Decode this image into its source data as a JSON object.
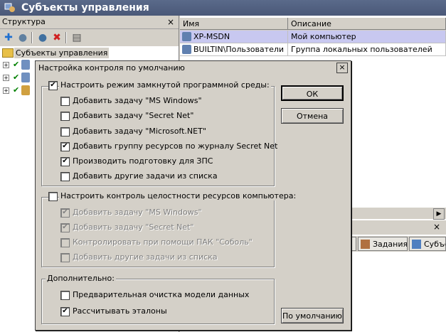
{
  "app": {
    "title": "Субъекты управления"
  },
  "left_pane": {
    "header": "Структура",
    "close_glyph": "×",
    "tree_root": "Субъекты управления"
  },
  "grid": {
    "columns": [
      "Имя",
      "Описание"
    ],
    "rows": [
      {
        "name": "XP-MSDN",
        "description": "Мой компьютер",
        "selected": true
      },
      {
        "name": "BUILTIN\\Пользователи",
        "description": "Группа локальных пользователей",
        "selected": false
      }
    ]
  },
  "bottom_panel": {
    "close_glyph": "×",
    "tabs": [
      "и",
      "Задания",
      "Субъе"
    ]
  },
  "dialog": {
    "title": "Настройка контроля по умолчанию",
    "close_glyph": "×",
    "group1": {
      "label": "Настроить режим замкнутой программной среды:",
      "checked": true,
      "items": [
        {
          "label": "Добавить задачу \"MS Windows\"",
          "checked": false
        },
        {
          "label": "Добавить задачу \"Secret Net\"",
          "checked": false
        },
        {
          "label": "Добавить задачу \"Microsoft.NET\"",
          "checked": false
        },
        {
          "label": "Добавить группу ресурсов по журналу Secret Net",
          "checked": true
        },
        {
          "label": "Производить подготовку для ЗПС",
          "checked": true
        },
        {
          "label": "Добавить другие задачи из списка",
          "checked": false
        }
      ]
    },
    "group2": {
      "label": "Настроить контроль целостности ресурсов компьютера:",
      "checked": false,
      "items": [
        {
          "label": "Добавить задачу \"MS Windows\"",
          "checked": true
        },
        {
          "label": "Добавить задачу \"Secret Net\"",
          "checked": true
        },
        {
          "label": "Контролировать при помощи ПАК \"Соболь\"",
          "checked": false
        },
        {
          "label": "Добавить другие задачи из списка",
          "checked": false
        }
      ]
    },
    "group3": {
      "label": "Дополнительно:",
      "items": [
        {
          "label": "Предварительная очистка модели данных",
          "checked": false
        },
        {
          "label": "Рассчитывать эталоны",
          "checked": true
        }
      ]
    },
    "buttons": {
      "ok": "ОК",
      "cancel": "Отмена",
      "defaults": "По умолчанию"
    }
  },
  "check_glyph": "✔"
}
